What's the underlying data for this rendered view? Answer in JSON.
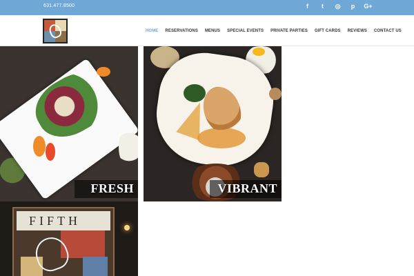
{
  "topbar": {
    "phone": "631.477.8500",
    "social": [
      {
        "icon": "facebook-icon",
        "glyph": "f"
      },
      {
        "icon": "twitter-icon",
        "glyph": "t"
      },
      {
        "icon": "instagram-icon",
        "glyph": "◎"
      },
      {
        "icon": "pinterest-icon",
        "glyph": "p"
      },
      {
        "icon": "google-plus-icon",
        "glyph": "G+"
      }
    ]
  },
  "header": {
    "nav": [
      "HOME",
      "RESERVATIONS",
      "MENUS",
      "SPECIAL EVENTS",
      "PRIVATE PARTIES",
      "GIFT CARDS",
      "REVIEWS",
      "CONTACT US"
    ],
    "active": "HOME"
  },
  "gallery": {
    "fresh_caption": "FRESH",
    "vibrant_caption": "VIBRANT",
    "sign_text": "FIFTH"
  },
  "colors": {
    "accent": "#6fa8d6"
  }
}
